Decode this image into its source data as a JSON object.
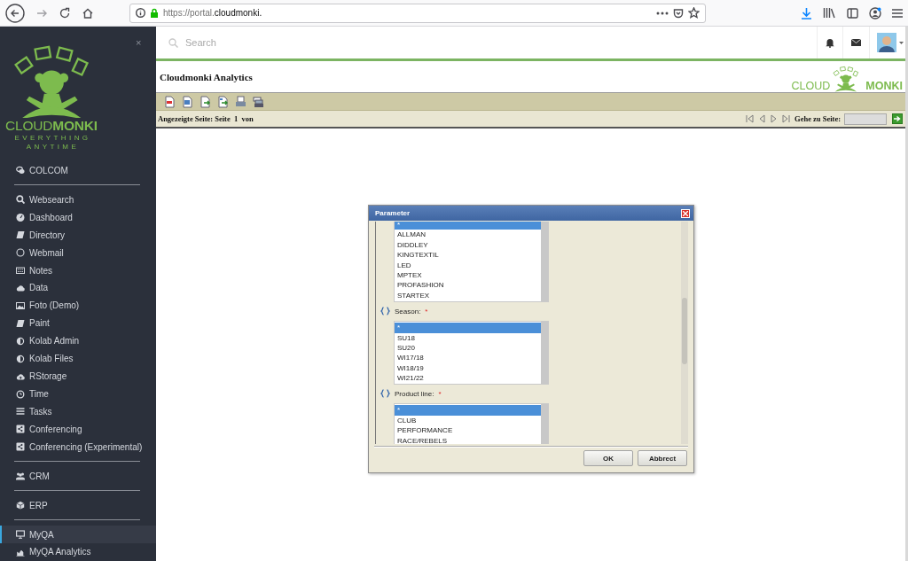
{
  "browser": {
    "url_host": "https://portal.",
    "url_domain": "cloudmonki."
  },
  "sidebar": {
    "close_glyph": "×",
    "logo": {
      "name": "CLOUD**MONKI**",
      "tagline_1": "EVERYTHING",
      "tagline_2": "ANYTIME"
    },
    "groups": [
      {
        "items": [
          {
            "label": "COLCOM",
            "selected": false
          }
        ]
      },
      {
        "items": [
          {
            "label": "Websearch",
            "selected": false
          },
          {
            "label": "Dashboard",
            "selected": false
          },
          {
            "label": "Directory",
            "selected": false
          },
          {
            "label": "Webmail",
            "selected": false
          },
          {
            "label": "Notes",
            "selected": false
          },
          {
            "label": "Data",
            "selected": false
          },
          {
            "label": "Foto (Demo)",
            "selected": false
          },
          {
            "label": "Paint",
            "selected": false
          },
          {
            "label": "Kolab Admin",
            "selected": false
          },
          {
            "label": "Kolab Files",
            "selected": false
          },
          {
            "label": "RStorage",
            "selected": false
          },
          {
            "label": "Time",
            "selected": false
          },
          {
            "label": "Tasks",
            "selected": false
          },
          {
            "label": "Conferencing",
            "selected": false
          },
          {
            "label": "Conferencing (Experimental)",
            "selected": false
          }
        ]
      },
      {
        "items": [
          {
            "label": "CRM",
            "selected": false
          }
        ]
      },
      {
        "items": [
          {
            "label": "ERP",
            "selected": false
          }
        ]
      },
      {
        "items": [
          {
            "label": "MyQA",
            "selected": true
          },
          {
            "label": "MyQA Analytics",
            "selected": false
          }
        ]
      }
    ]
  },
  "topbar": {
    "search": {
      "placeholder": "Search"
    }
  },
  "report": {
    "title": "Cloudmonki Analytics",
    "logo_left": "CLOUD",
    "logo_right": "MONKI",
    "page_label": "Angezeigte Seite: Seite  1  von",
    "goto_label": "Gehe zu Seite:"
  },
  "dialog": {
    "title": "Parameter",
    "parameters": [
      {
        "options": [
          {
            "text": "*",
            "selected": true
          },
          {
            "text": "ALLMAN",
            "selected": false
          },
          {
            "text": "DIDDLEY",
            "selected": false
          },
          {
            "text": "KINGTEXTIL",
            "selected": false
          },
          {
            "text": "LED",
            "selected": false
          },
          {
            "text": "MPTEX",
            "selected": false
          },
          {
            "text": "PROFASHION",
            "selected": false
          },
          {
            "text": "STARTEX",
            "selected": false
          }
        ]
      },
      {
        "label": "Season:",
        "required_mark": "*",
        "options": [
          {
            "text": "*",
            "selected": true
          },
          {
            "text": "SU18",
            "selected": false
          },
          {
            "text": "SU20",
            "selected": false
          },
          {
            "text": "WI17/18",
            "selected": false
          },
          {
            "text": "WI18/19",
            "selected": false
          },
          {
            "text": "WI21/22",
            "selected": false
          }
        ]
      },
      {
        "label": "Product line:",
        "required_mark": "*",
        "options": [
          {
            "text": "*",
            "selected": true
          },
          {
            "text": "CLUB",
            "selected": false
          },
          {
            "text": "PERFORMANCE",
            "selected": false
          },
          {
            "text": "RACE/REBELS",
            "selected": false
          }
        ]
      }
    ],
    "buttons": [
      "OK",
      "Abbrect"
    ]
  }
}
